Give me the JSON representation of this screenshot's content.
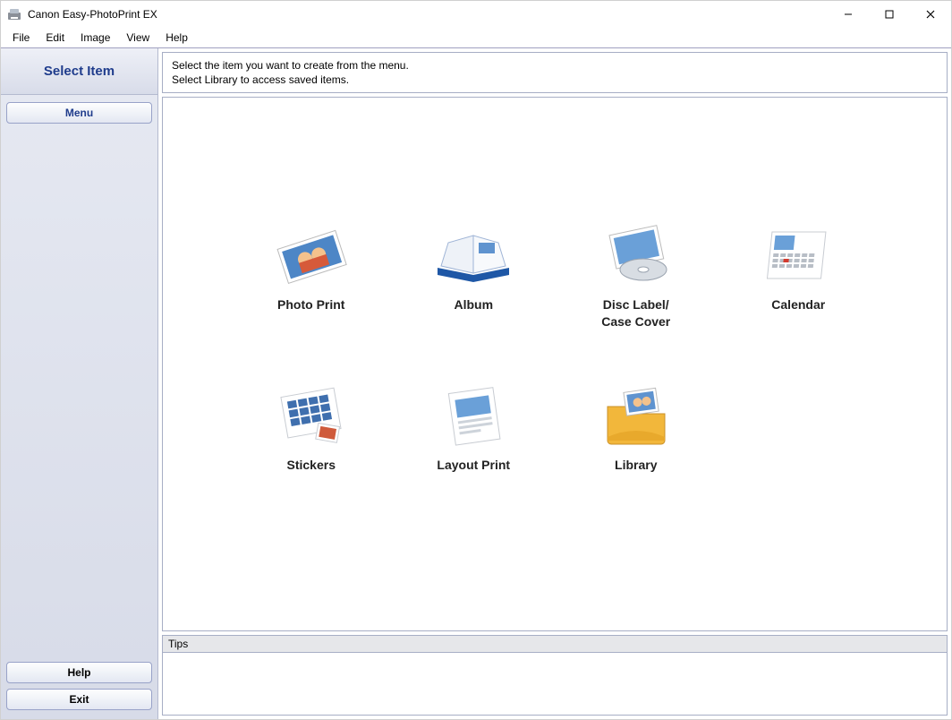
{
  "titlebar": {
    "appName": "Canon Easy-PhotoPrint EX"
  },
  "menubar": {
    "items": [
      "File",
      "Edit",
      "Image",
      "View",
      "Help"
    ]
  },
  "sidebar": {
    "header": "Select Item",
    "tabLabel": "Menu",
    "helpLabel": "Help",
    "exitLabel": "Exit"
  },
  "instruction": {
    "line1": "Select the item you want to create from the menu.",
    "line2": "Select Library to access saved items."
  },
  "items": [
    {
      "id": "photo-print",
      "label": "Photo Print"
    },
    {
      "id": "album",
      "label": "Album"
    },
    {
      "id": "disc-label",
      "label": "Disc Label/\nCase Cover"
    },
    {
      "id": "calendar",
      "label": "Calendar"
    },
    {
      "id": "stickers",
      "label": "Stickers"
    },
    {
      "id": "layout-print",
      "label": "Layout Print"
    },
    {
      "id": "library",
      "label": "Library"
    }
  ],
  "tips": {
    "header": "Tips"
  }
}
